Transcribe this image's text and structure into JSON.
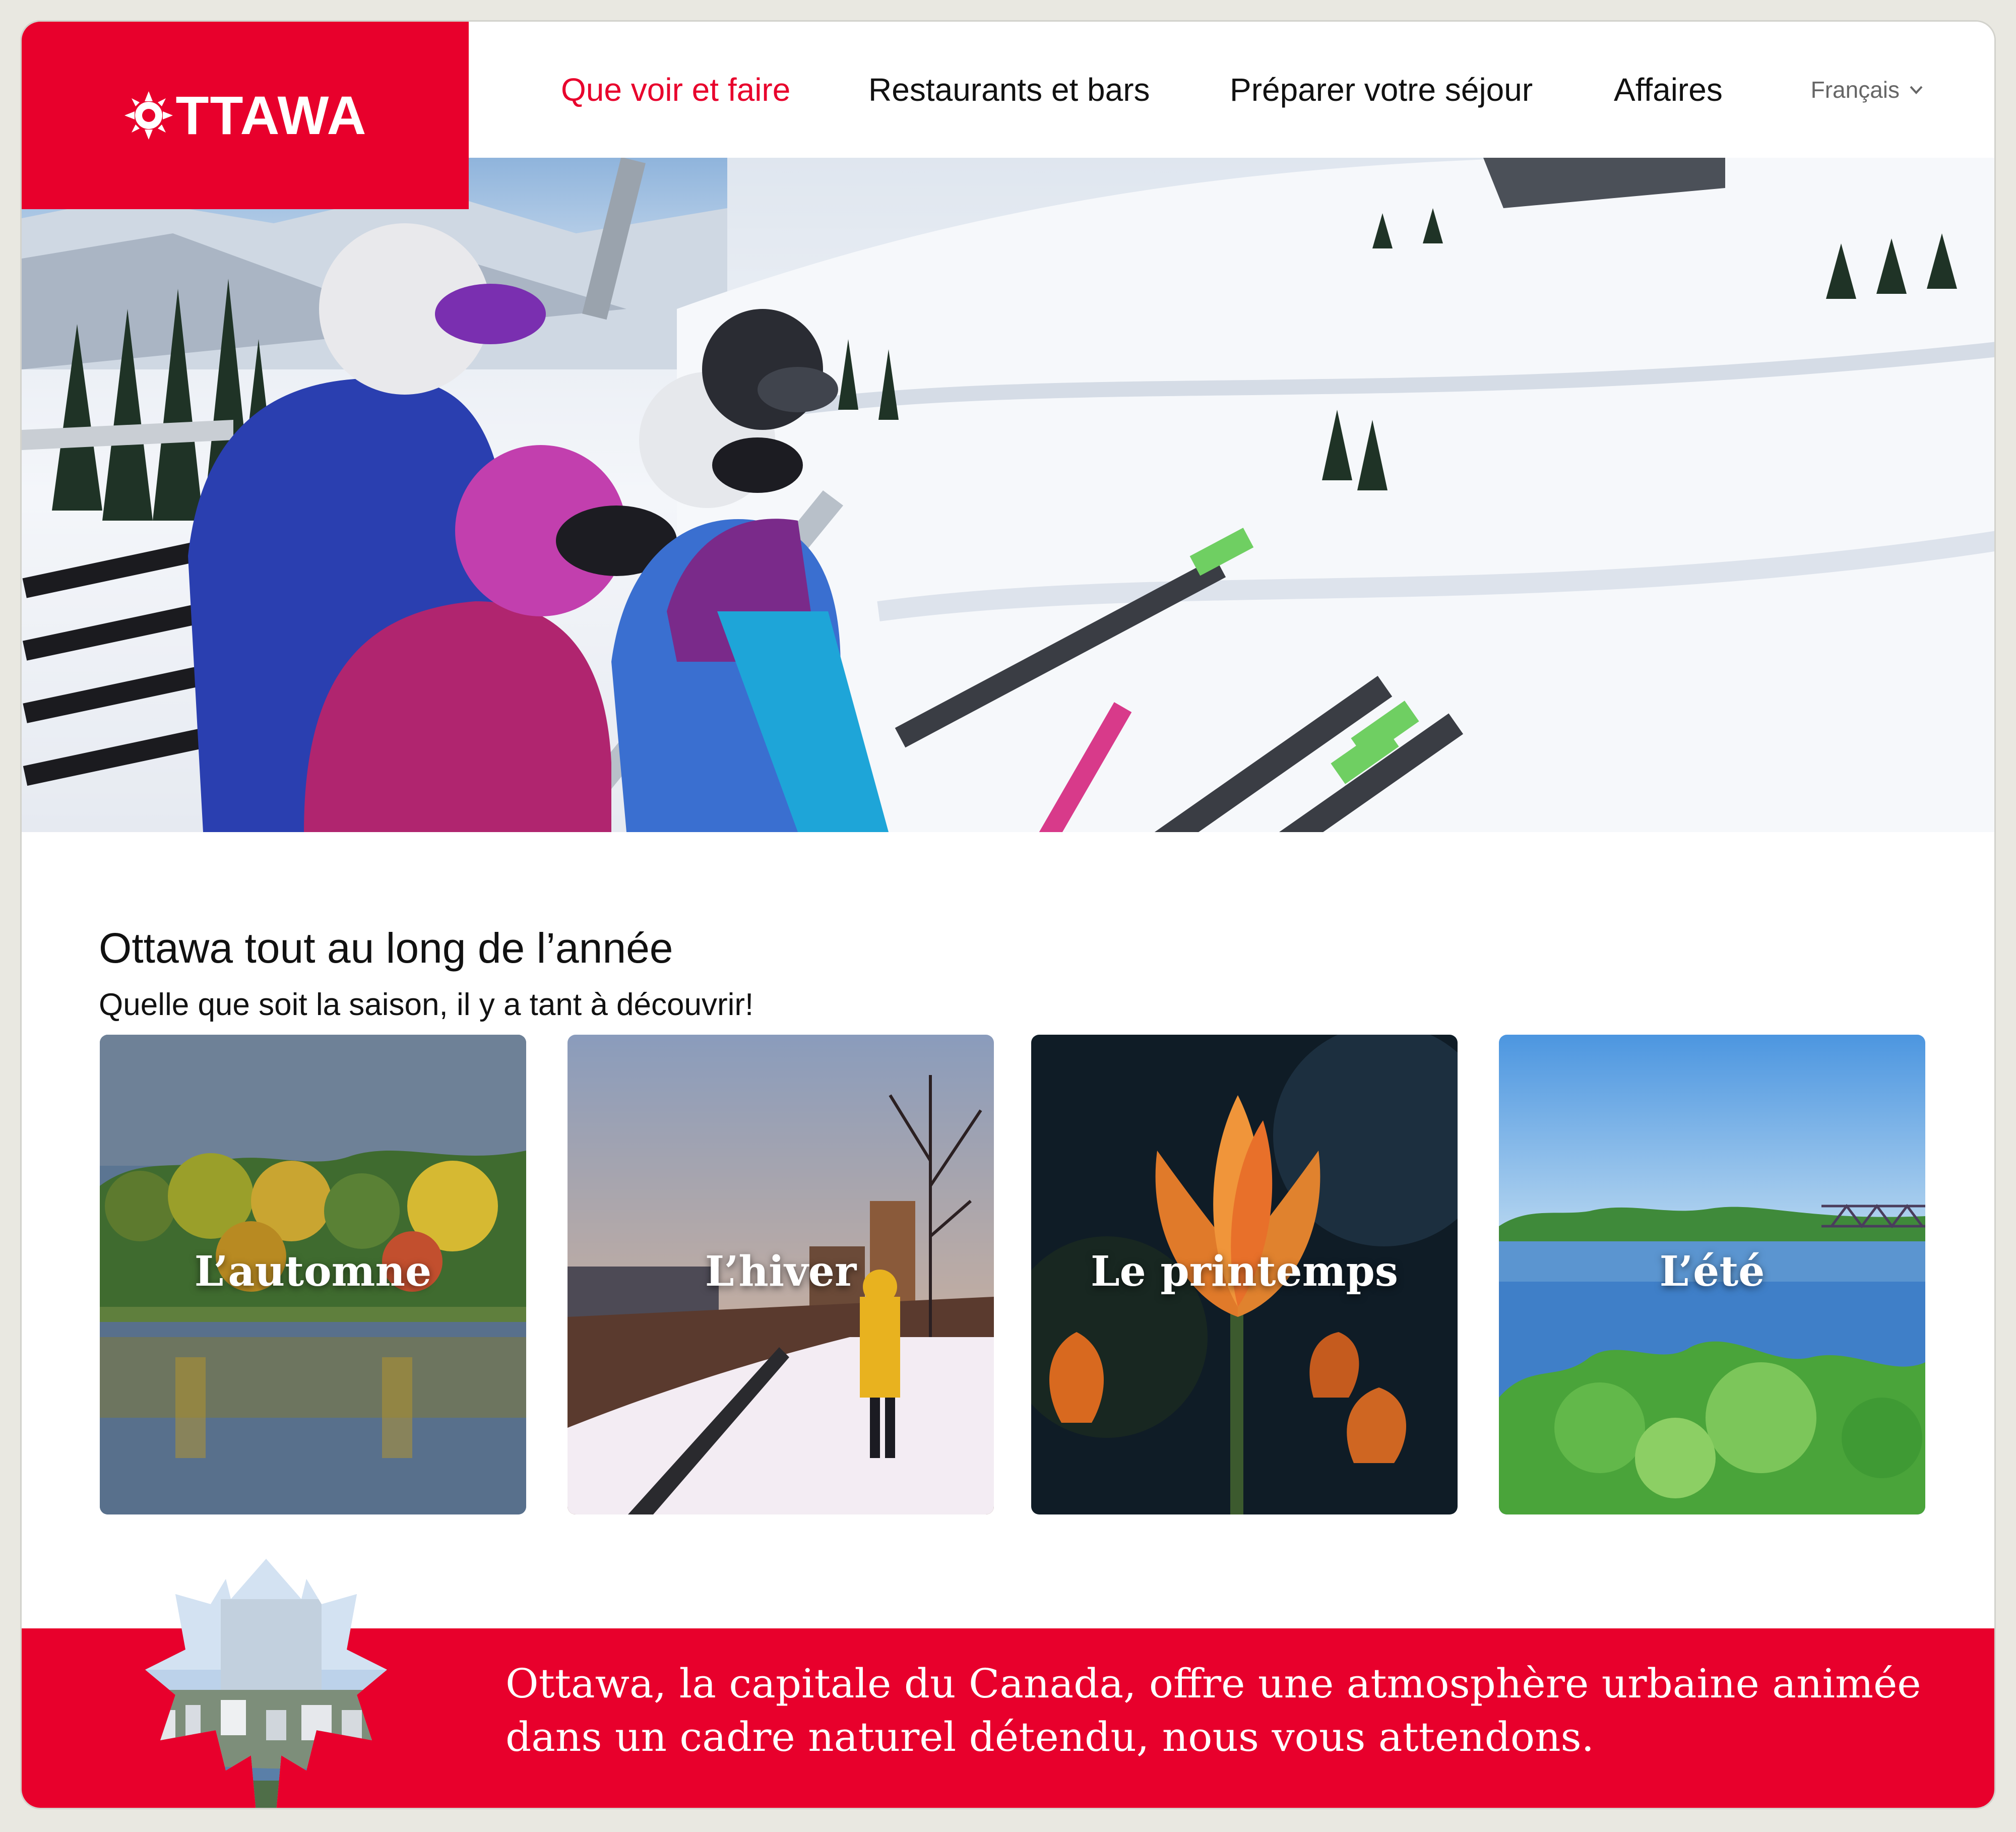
{
  "header": {
    "logo_text": "TTAWA",
    "logo_full": "OTTAWA",
    "brand_color": "#e8002c",
    "nav": [
      {
        "label": "Que voir et faire",
        "active": true
      },
      {
        "label": "Restaurants et bars",
        "active": false
      },
      {
        "label": "Préparer votre séjour",
        "active": false
      },
      {
        "label": "Affaires",
        "active": false
      }
    ],
    "language": {
      "selected": "Français",
      "icon": "chevron-down-icon"
    }
  },
  "hero": {
    "image": "family-on-ski-chairlift-snowy-mountain"
  },
  "seasons": {
    "title": "Ottawa tout au long de l’année",
    "subtitle": "Quelle que soit la saison, il y a tant à découvrir!",
    "cards": [
      {
        "label": "L’automne",
        "image": "autumn-trees-reflected-in-lake"
      },
      {
        "label": "L’hiver",
        "image": "winter-snowy-path-city-sunset"
      },
      {
        "label": "Le printemps",
        "image": "orange-tulips"
      },
      {
        "label": "L’été",
        "image": "summer-river-bridge"
      }
    ]
  },
  "footer_band": {
    "text": "Ottawa, la capitale du Canada, offre une atmosphère urbaine animée dans un cadre naturel détendu, nous vous attendons.",
    "icon": "maple-leaf-city-icon"
  }
}
